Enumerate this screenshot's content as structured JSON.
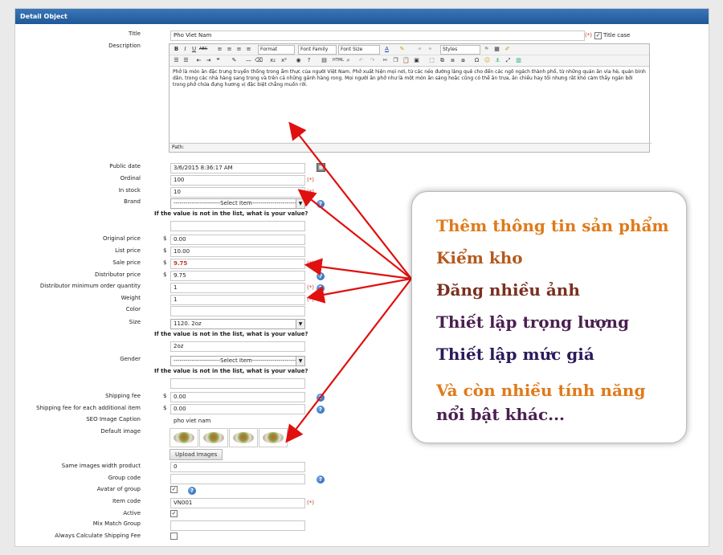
{
  "panel": {
    "title": "Detail Object"
  },
  "form": {
    "title_label": "Title",
    "title_value": "Pho Viet Nam",
    "title_case_label": "Title case",
    "required_mark": "(*)",
    "description_label": "Description",
    "editor": {
      "format": "Format",
      "font_family": "Font Family",
      "font_size": "Font Size",
      "styles": "Styles",
      "content": "Phở là món ăn đặc trưng truyền thống trong ẩm thực của người Việt Nam. Phở xuất hiện mọi nơi, từ các nẻo đường làng quê cho đến các ngõ ngách thành phố, từ những quán ăn vỉa hè, quán bình dân, trong các nhà hàng sang trọng và trên cả những gánh hàng rong. Mọi người ăn phở như là một món ăn sáng hoặc cũng có thể ăn trưa, ăn chiều hay tối nhưng rất khó cảm thấy ngán bởi trong phở chứa đựng hương vị đặc biệt chẳng muốn rời.",
      "path": "Path:"
    },
    "public_date_label": "Public date",
    "public_date_value": "3/6/2015 8:36:17 AM",
    "ordinal_label": "Ordinal",
    "ordinal_value": "100",
    "in_stock_label": "In stock",
    "in_stock_value": "10",
    "brand_label": "Brand",
    "select_item": "-----------------------Select Item-----------------------",
    "not_in_list": "If the value is not in the list, what is your value?",
    "original_price_label": "Original price",
    "original_price_value": "0.00",
    "list_price_label": "List price",
    "list_price_value": "10.00",
    "sale_price_label": "Sale price",
    "sale_price_value": "9.75",
    "distributor_price_label": "Distributor price",
    "distributor_price_value": "9.75",
    "dist_min_label": "Distributor minimum order quantity",
    "dist_min_value": "1",
    "weight_label": "Weight",
    "weight_value": "1",
    "color_label": "Color",
    "size_label": "Size",
    "size_value": "1120. 2oz",
    "size_other_value": "2oz",
    "gender_label": "Gender",
    "shipping_fee_label": "Shipping fee",
    "shipping_fee_value": "0.00",
    "shipping_each_label": "Shipping fee for each additional item",
    "shipping_each_value": "0.00",
    "seo_caption_label": "SEO Image Caption",
    "seo_caption_value": "pho viet nam",
    "default_image_label": "Default image",
    "upload_images": "Upload Images",
    "same_images_label": "Same images width product",
    "same_images_value": "0",
    "group_code_label": "Group code",
    "avatar_group_label": "Avatar of group",
    "item_code_label": "Item code",
    "item_code_value": "VN001",
    "active_label": "Active",
    "mix_match_label": "Mix Match Group",
    "always_calc_label": "Always Calculate Shipping Fee",
    "currency": "$"
  },
  "callout": {
    "line1": "Thêm thông tin sản phẩm",
    "line2": "Kiểm kho",
    "line3": "Đăng nhiều ảnh",
    "line4": "Thiết lập trọng lượng",
    "line5": "Thiết lập mức giá",
    "line6": "Và còn nhiều tính năng",
    "line7": "nổi bật khác..."
  },
  "colors": {
    "header_blue": "#1f5896",
    "arrow_red": "#e01010",
    "orange": "#e07a1a",
    "dark_orange": "#b45a1e",
    "brown": "#7a3020",
    "purple": "#4a2050",
    "indigo": "#2a1a5a",
    "sale_red": "#c0392b"
  }
}
